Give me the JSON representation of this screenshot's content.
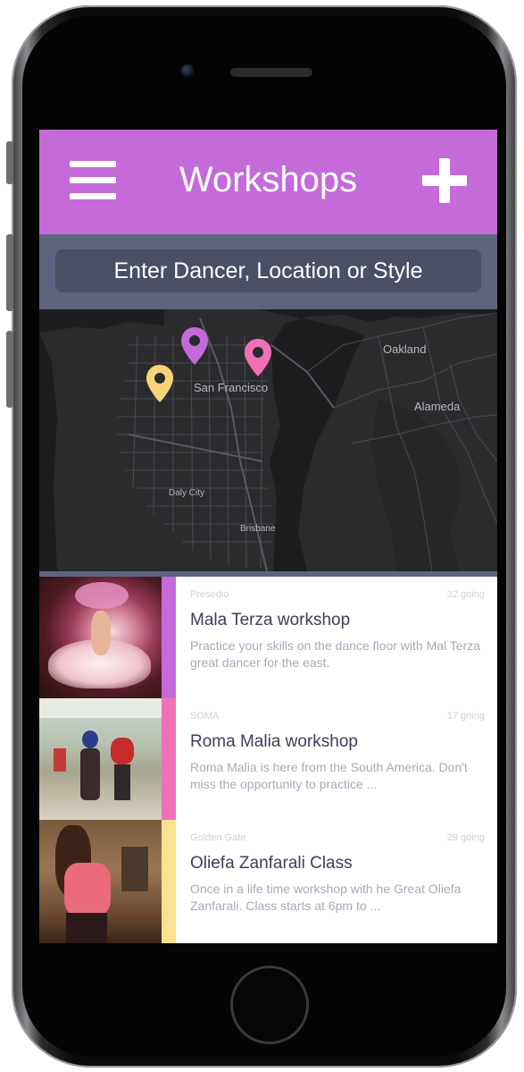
{
  "header": {
    "title": "Workshops",
    "menu_icon": "hamburger-menu-icon",
    "add_icon": "plus-icon",
    "background": "#c46bd9"
  },
  "search": {
    "placeholder": "Enter Dancer, Location or Style",
    "value": ""
  },
  "map": {
    "labels": [
      "San Francisco",
      "Oakland",
      "Alameda",
      "Daly City",
      "Brisbane"
    ],
    "pins": [
      {
        "color": "#f6d478",
        "icon": "map-pin-icon"
      },
      {
        "color": "#c46bd9",
        "icon": "map-pin-icon"
      },
      {
        "color": "#ee71b8",
        "icon": "map-pin-icon"
      }
    ]
  },
  "workshops": [
    {
      "location": "Presedio",
      "going": "32 going",
      "title": "Mala Terza workshop",
      "description": "Practice your skills on the dance floor with Mal Terza great dancer for the east.",
      "accent": "#c46bd9"
    },
    {
      "location": "SOMA",
      "going": "17 going",
      "title": "Roma Malia workshop",
      "description": "Roma Malia is here from the South America. Don't miss the opportunity to practice ...",
      "accent": "#ee71b8"
    },
    {
      "location": "Golden Gate",
      "going": "29 going",
      "title": "Oliefa Zanfarali Class",
      "description": "Once in a life time workshop with he Great Oliefa Zanfarali. Class starts at 6pm to ...",
      "accent": "#fbe08f"
    }
  ]
}
